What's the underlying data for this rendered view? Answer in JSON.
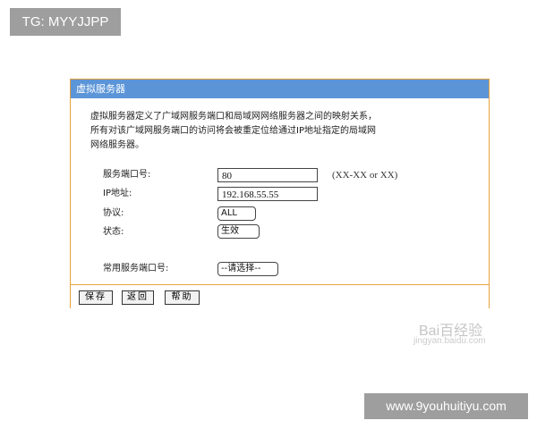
{
  "tag": "TG: MYYJJPP",
  "panel": {
    "title": "虚拟服务器",
    "description": [
      "虚拟服务器定义了广域网服务端口和局域网网络服务器之间的映射关系，",
      "所有对该广域网服务端口的访问将会被重定位给通过IP地址指定的局域网",
      "网络服务器。"
    ],
    "fields": {
      "port_label": "服务端口号:",
      "port_value": "80",
      "port_hint": "(XX-XX or XX)",
      "ip_label": "IP地址:",
      "ip_value": "192.168.55.55",
      "protocol_label": "协议:",
      "protocol_value": "ALL",
      "status_label": "状态:",
      "status_value": "生效",
      "common_port_label": "常用服务端口号:",
      "common_port_value": "--请选择--"
    },
    "buttons": {
      "save": "保存",
      "back": "返回",
      "help": "帮助"
    }
  },
  "watermark": {
    "brand": "Bai百经验",
    "sub": "jingyan.baidu.com"
  },
  "url": "www.9youhuitiyu.com"
}
